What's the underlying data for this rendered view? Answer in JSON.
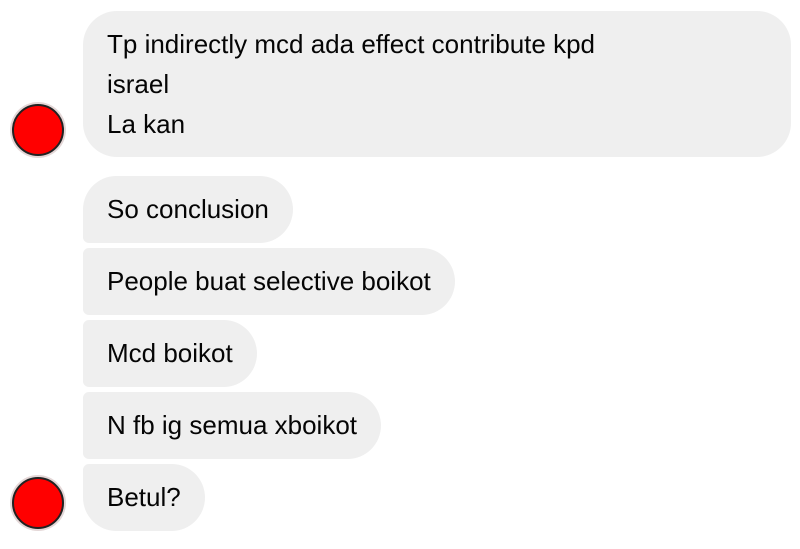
{
  "conversation": {
    "group1": {
      "avatar_color": "#ff0000",
      "message_lines": [
        "Tp indirectly mcd ada effect contribute kpd",
        "israel",
        "La kan"
      ]
    },
    "group2": {
      "avatar_color": "#ff0000",
      "messages": [
        "So conclusion",
        "People buat selective boikot",
        "Mcd boikot",
        "N fb ig semua xboikot",
        "Betul?"
      ]
    }
  },
  "theme": {
    "bubble_color": "#efefef",
    "text_color": "#050505",
    "background": "#ffffff"
  }
}
